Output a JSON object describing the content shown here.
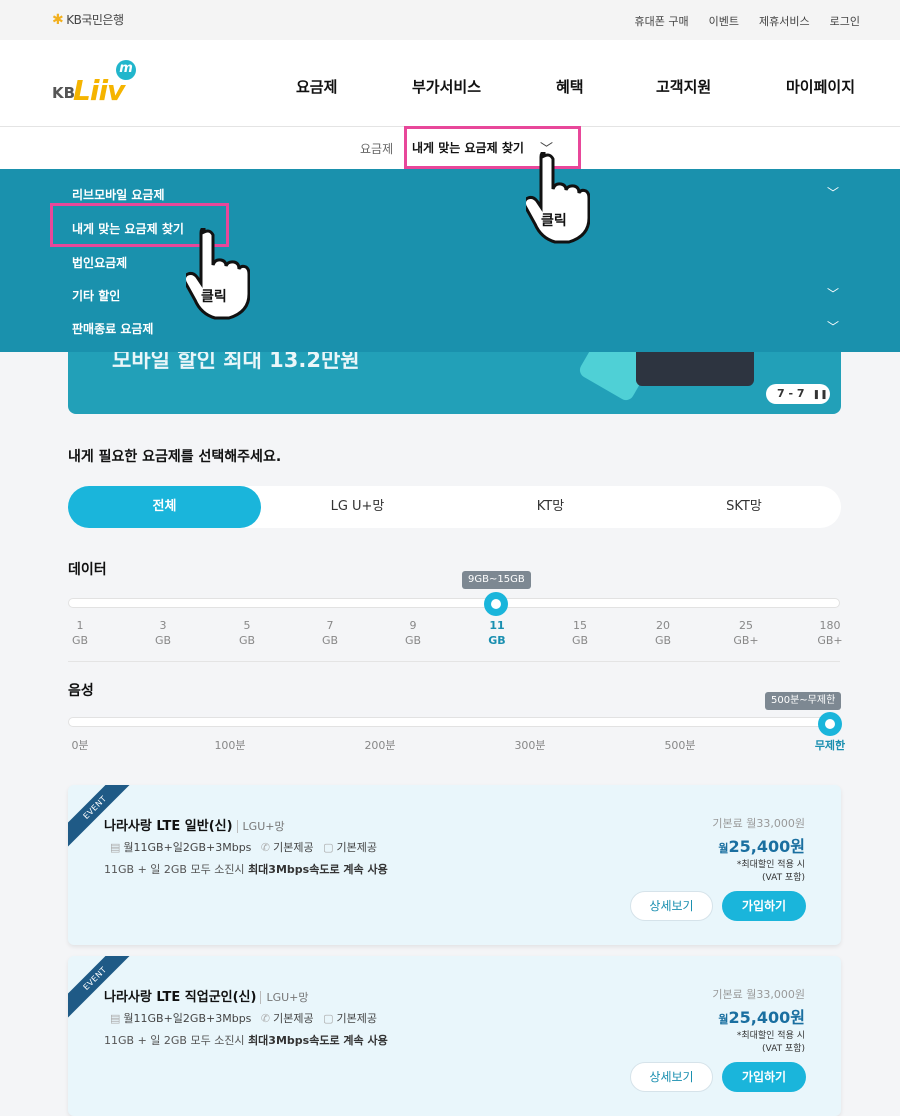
{
  "utility": {
    "bank": "KB국민은행",
    "links": [
      "휴대폰 구매",
      "이벤트",
      "제휴서비스",
      "로그인"
    ]
  },
  "logo": {
    "kb": "KB",
    "liiv": "Liiv",
    "m": "m"
  },
  "gnb": [
    "요금제",
    "부가서비스",
    "혜택",
    "고객지원",
    "마이페이지"
  ],
  "subnav": {
    "label": "요금제",
    "current": "내게 맞는 요금제 찾기"
  },
  "dropdown": [
    "리브모바일 요금제",
    "내게 맞는 요금제 찾기",
    "법인요금제",
    "기타 할인",
    "판매종료 요금제"
  ],
  "annotation": {
    "click_label": "클릭"
  },
  "banner": {
    "text": "모바일 할인 최대 13.2만원",
    "counter": "7 - 7"
  },
  "select_title": "내게 필요한 요금제를 선택해주세요.",
  "tabs": [
    "전체",
    "LG U+망",
    "KT망",
    "SKT망"
  ],
  "data_filter": {
    "title": "데이터",
    "tooltip": "9GB~15GB",
    "ticks": [
      [
        "1",
        "GB"
      ],
      [
        "3",
        "GB"
      ],
      [
        "5",
        "GB"
      ],
      [
        "7",
        "GB"
      ],
      [
        "9",
        "GB"
      ],
      [
        "11",
        "GB"
      ],
      [
        "15",
        "GB"
      ],
      [
        "20",
        "GB"
      ],
      [
        "25",
        "GB+"
      ],
      [
        "180",
        "GB+"
      ]
    ],
    "selected_index": 5
  },
  "voice_filter": {
    "title": "음성",
    "tooltip": "500분~무제한",
    "ticks": [
      "0분",
      "100분",
      "200분",
      "300분",
      "500분",
      "무제한"
    ],
    "selected_index": 5
  },
  "plans": [
    {
      "badge": "EVENT",
      "name": "나라사랑 LTE 일반(신)",
      "network": "LGU+망",
      "data": "월11GB+일2GB+3Mbps",
      "voice": "기본제공",
      "sms": "기본제공",
      "desc_pre": "11GB + 일 2GB 모두 소진시 ",
      "desc_bold": "최대3Mbps속도로 계속 사용",
      "base": "기본료 월33,000원",
      "price_unit": "월",
      "price": "25,400원",
      "note1": "*최대할인 적용 시",
      "note2": "(VAT 포함)",
      "btn_detail": "상세보기",
      "btn_join": "가입하기"
    },
    {
      "badge": "EVENT",
      "name": "나라사랑 LTE 직업군인(신)",
      "network": "LGU+망",
      "data": "월11GB+일2GB+3Mbps",
      "voice": "기본제공",
      "sms": "기본제공",
      "desc_pre": "11GB + 일 2GB 모두 소진시 ",
      "desc_bold": "최대3Mbps속도로 계속 사용",
      "base": "기본료 월33,000원",
      "price_unit": "월",
      "price": "25,400원",
      "note1": "*최대할인 적용 시",
      "note2": "(VAT 포함)",
      "btn_detail": "상세보기",
      "btn_join": "가입하기"
    }
  ],
  "colors": {
    "accent": "#1ab5db",
    "dropdown_bg": "#1a91ad",
    "highlight": "#e8479a",
    "price": "#1a6fa0"
  }
}
